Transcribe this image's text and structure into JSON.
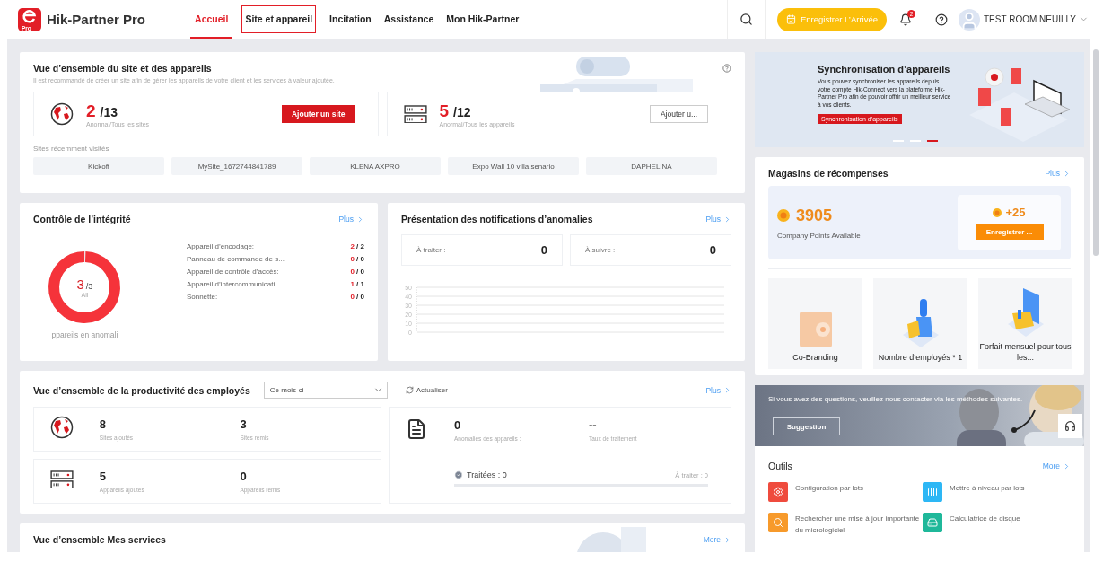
{
  "header": {
    "logo_badge": "Pro",
    "app_name": "Hik-Partner Pro",
    "nav": [
      {
        "label": "Accueil",
        "selected": true,
        "outlined": false
      },
      {
        "label": "Site et appareil",
        "selected": false,
        "outlined": true
      },
      {
        "label": "Incitation",
        "selected": false,
        "outlined": false
      },
      {
        "label": "Assistance",
        "selected": false,
        "outlined": false
      },
      {
        "label": "Mon Hik-Partner",
        "selected": false,
        "outlined": false
      }
    ],
    "checkin_button": "Enregistrer L’Arrivée",
    "notification_count": "2",
    "user": "TEST ROOM NEUILLY"
  },
  "site_overview": {
    "title": "Vue d’ensemble du site et des appareils",
    "subtitle": "Il est recommandé de créer un site afin de gérer les appareils de votre client et les services à valeur ajoutée.",
    "stats": [
      {
        "kind": "sites",
        "count": "2",
        "total": "/13",
        "caption": "Anormal/Tous les sites",
        "button": "Ajouter un site",
        "primary": true
      },
      {
        "kind": "devices",
        "count": "5",
        "total": "/12",
        "caption": "Anormal/Tous les appareils",
        "button": "Ajouter u...",
        "primary": false
      }
    ],
    "recent_label": "Sites récemment visités",
    "recent_sites": [
      "Kickoff",
      "MySite_1672744841789",
      "KLENA AXPRO",
      "Expo Wall 10 villa senario",
      "DAPHELINA"
    ]
  },
  "integrity": {
    "title": "Contrôle de l’intégrité",
    "more": "Plus",
    "donut": {
      "count": "3",
      "total": "/3",
      "label": "All",
      "level": 1
    },
    "caption": "ppareils en anomali",
    "rows": [
      {
        "label": "Appareil d’encodage:",
        "count": "2",
        "total": "/ 2"
      },
      {
        "label": "Panneau de commande de s...",
        "count": "0",
        "total": "/ 0"
      },
      {
        "label": "Appareil de contrôle d’accès:",
        "count": "0",
        "total": "/ 0"
      },
      {
        "label": "Appareil d’intercommunicati...",
        "count": "1",
        "total": "/ 1"
      },
      {
        "label": "Sonnette:",
        "count": "0",
        "total": "/ 0"
      }
    ]
  },
  "anomalies": {
    "title": "Présentation des notifications d’anomalies",
    "more": "Plus",
    "counters": [
      {
        "label": "À traiter :",
        "value": "0"
      },
      {
        "label": "À suivre :",
        "value": "0"
      }
    ],
    "axis_labels": [
      "50",
      "40",
      "30",
      "20",
      "10",
      "0"
    ]
  },
  "productivity": {
    "title": "Vue d’ensemble de la productivité des employés",
    "period": "Ce mois-ci",
    "refresh": "Actualiser",
    "more": "Plus",
    "groups": [
      {
        "kind": "sites",
        "stats": [
          {
            "value": "8",
            "label": "Sites ajoutés"
          },
          {
            "value": "3",
            "label": "Sites remis"
          }
        ]
      },
      {
        "kind": "devices",
        "stats": [
          {
            "value": "5",
            "label": "Appareils ajoutés"
          },
          {
            "value": "0",
            "label": "Appareils remis"
          }
        ]
      }
    ],
    "anomaly": {
      "stats": [
        {
          "value": "0",
          "label": "Anomalies des appareils :"
        },
        {
          "value": "--",
          "label": "Taux de traitement"
        }
      ],
      "done": "Traitées : 0",
      "pending": "À traiter : 0",
      "level": 0
    }
  },
  "services": {
    "title": "Vue d’ensemble Mes services",
    "more": "More"
  },
  "promo": {
    "title": "Synchronisation d’appareils",
    "text": "Vous pouvez synchroniser les appareils depuis votre compte Hik-Connect vers la plateforme Hik-Partner Pro afin de pouvoir offrir un meilleur service à vos clients.",
    "button": "Synchronisation d’appareils",
    "slides": [
      {
        "selected": false
      },
      {
        "selected": false
      },
      {
        "selected": true
      }
    ]
  },
  "rewards": {
    "title": "Magasins de récompenses",
    "more": "Plus",
    "points": "3905",
    "points_label": "Company Points Available",
    "bonus": "+25",
    "checkin": "Enregistrer ...",
    "items": [
      {
        "kind": "cobranding",
        "label": "Co-Branding"
      },
      {
        "kind": "employees",
        "label": "Nombre d’employés * 1"
      },
      {
        "kind": "monthly",
        "label": "Forfait mensuel pour tous les..."
      }
    ]
  },
  "contact": {
    "text": "Si vous avez des questions, veuillez nous contacter via les méthodes suivantes.",
    "button": "Suggestion"
  },
  "tools": {
    "title": "Outils",
    "more": "More",
    "items": [
      {
        "kind": "config",
        "label": "Configuration par lots",
        "color": "#ef4b3d"
      },
      {
        "kind": "upgrade",
        "label": "Mettre à niveau par lots",
        "color": "#2db7f5"
      },
      {
        "kind": "firmware",
        "label": "Rechercher une mise à jour importante du micrologiciel",
        "color": "#f79a2b"
      },
      {
        "kind": "disk",
        "label": "Calculatrice de disque",
        "color": "#1fb89a"
      }
    ]
  }
}
